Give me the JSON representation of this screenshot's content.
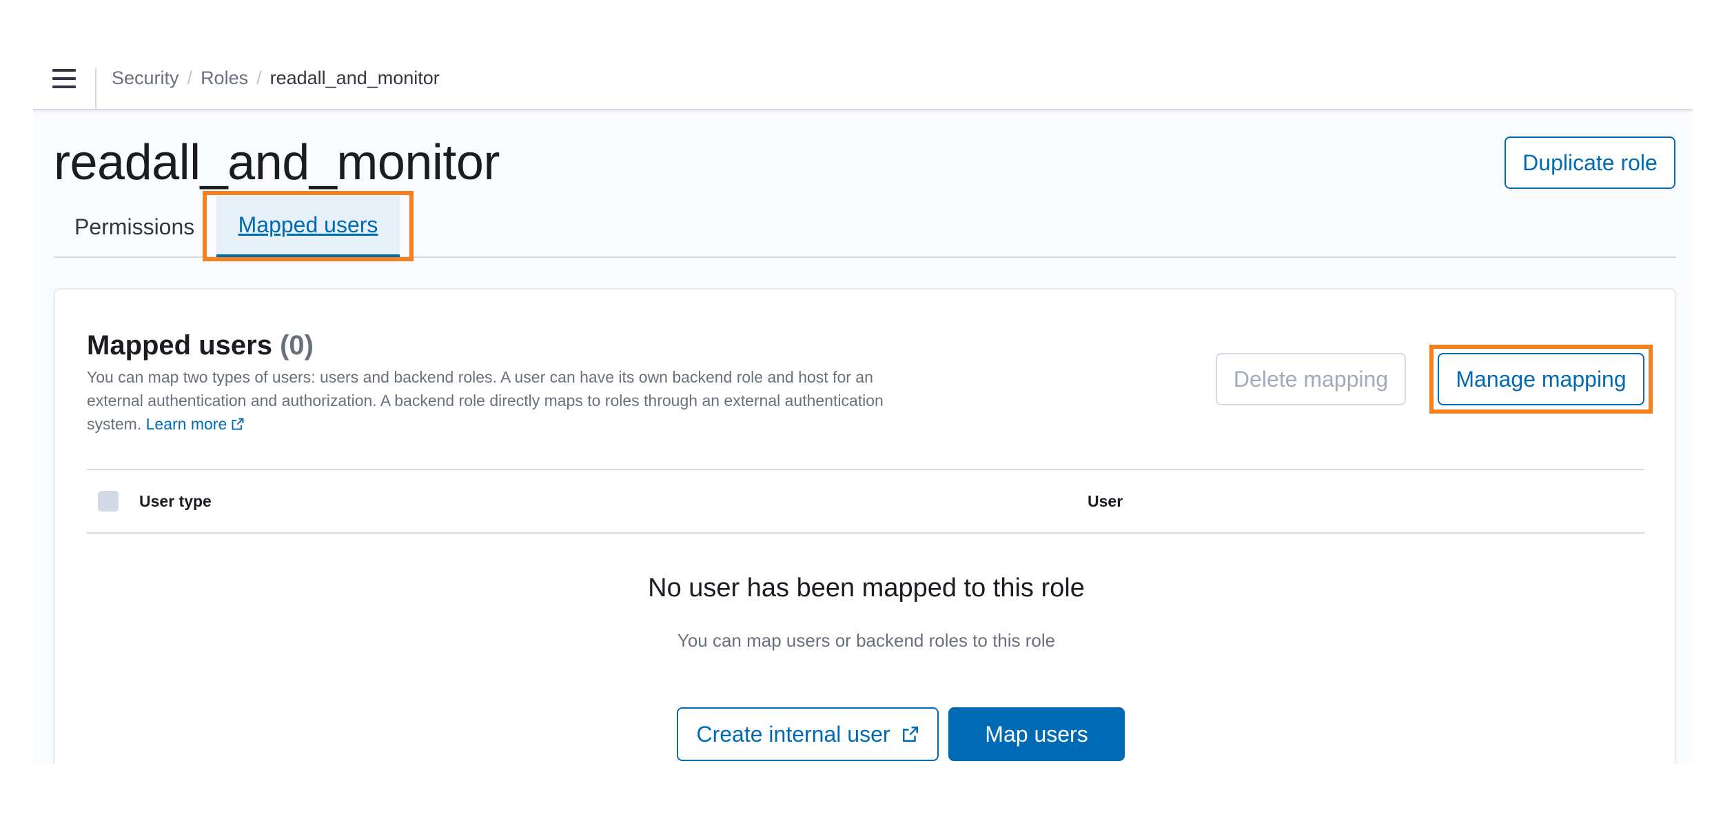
{
  "breadcrumb": {
    "items": [
      "Security",
      "Roles"
    ],
    "current": "readall_and_monitor",
    "separator": "/"
  },
  "page": {
    "title": "readall_and_monitor",
    "duplicate_label": "Duplicate role"
  },
  "tabs": [
    {
      "label": "Permissions",
      "selected": false
    },
    {
      "label": "Mapped users",
      "selected": true
    }
  ],
  "panel": {
    "title": "Mapped users",
    "count": "(0)",
    "description": "You can map two types of users: users and backend roles. A user can have its own backend role and host for an external authentication and authorization. A backend role directly maps to roles through an external authentication system.",
    "learn_more": "Learn more",
    "delete_label": "Delete mapping",
    "manage_label": "Manage mapping"
  },
  "table": {
    "columns": [
      "User type",
      "User"
    ]
  },
  "empty": {
    "title": "No user has been mapped to this role",
    "description": "You can map users or backend roles to this role",
    "create_label": "Create internal user",
    "map_label": "Map users"
  },
  "icons": {
    "menu": "hamburger-icon",
    "external": "external-link-icon"
  },
  "colors": {
    "primary": "#006bb4",
    "highlight": "#f5801f"
  }
}
